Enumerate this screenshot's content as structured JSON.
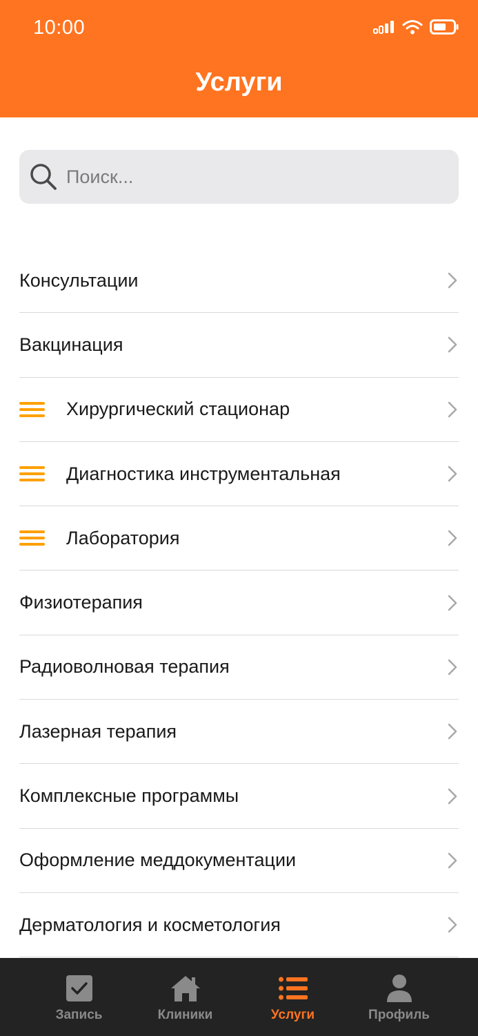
{
  "status_bar": {
    "time": "10:00"
  },
  "header": {
    "title": "Услуги"
  },
  "search": {
    "placeholder": "Поиск..."
  },
  "services": [
    {
      "label": "Консультации",
      "reorderable": false
    },
    {
      "label": "Вакцинация",
      "reorderable": false
    },
    {
      "label": "Хирургический стационар",
      "reorderable": true
    },
    {
      "label": "Диагностика инструментальная",
      "reorderable": true
    },
    {
      "label": "Лаборатория",
      "reorderable": true
    },
    {
      "label": "Физиотерапия",
      "reorderable": false
    },
    {
      "label": "Радиоволновая терапия",
      "reorderable": false
    },
    {
      "label": "Лазерная терапия",
      "reorderable": false
    },
    {
      "label": "Комплексные программы",
      "reorderable": false
    },
    {
      "label": "Оформление меддокументации",
      "reorderable": false
    },
    {
      "label": "Дерматология и косметология",
      "reorderable": false
    }
  ],
  "tabbar": {
    "tabs": [
      {
        "label": "Запись",
        "icon": "checkbox-icon",
        "active": false
      },
      {
        "label": "Клиники",
        "icon": "home-icon",
        "active": false
      },
      {
        "label": "Услуги",
        "icon": "list-icon",
        "active": true
      },
      {
        "label": "Профиль",
        "icon": "person-icon",
        "active": false
      }
    ]
  },
  "colors": {
    "accent": "#FF7420",
    "drag_handle": "#FFA000",
    "tabbar_bg": "#232323",
    "inactive": "#8a8a8a"
  }
}
